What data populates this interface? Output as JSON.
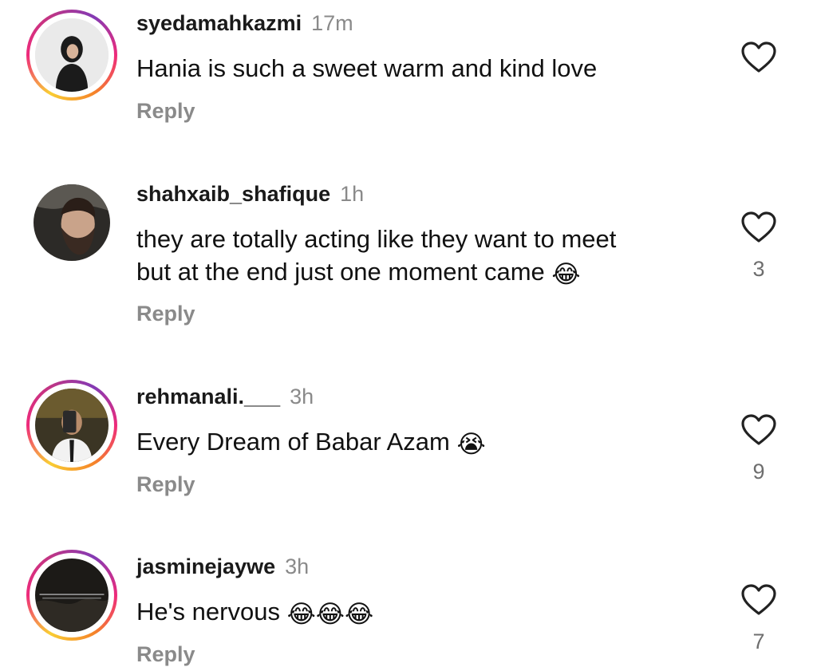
{
  "comments": [
    {
      "username": "syedamahkazmi",
      "time": "17m",
      "text": "Hania is such a sweet warm and kind love",
      "emoji": "",
      "reply_label": "Reply",
      "likes": "",
      "story_ring": true
    },
    {
      "username": "shahxaib_shafique",
      "time": "1h",
      "text": "they are totally acting like they want to meet\nbut at the end just one moment came ",
      "emoji": "😂",
      "reply_label": "Reply",
      "likes": "3",
      "story_ring": false
    },
    {
      "username": "rehmanali.___",
      "time": "3h",
      "text": "Every Dream of Babar Azam ",
      "emoji": "😭",
      "reply_label": "Reply",
      "likes": "9",
      "story_ring": true
    },
    {
      "username": "jasminejaywe",
      "time": "3h",
      "text": "He's nervous ",
      "emoji": "😂😂😂",
      "reply_label": "Reply",
      "likes": "7",
      "story_ring": true
    }
  ],
  "icons": {
    "like": "heart-outline-icon"
  },
  "colors": {
    "text": "#111111",
    "muted": "#8a8a8a",
    "story_gradient_start": "#f9ce34",
    "story_gradient_end": "#833ab4"
  }
}
